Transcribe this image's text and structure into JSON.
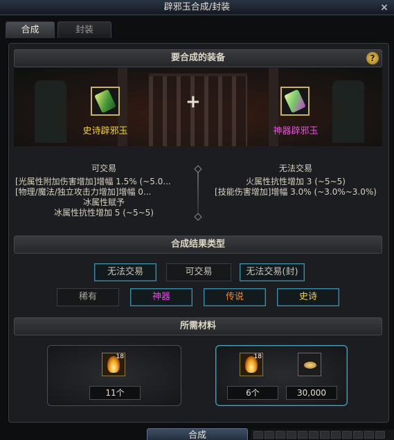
{
  "window": {
    "title": "辟邪玉合成/封装",
    "close_label": "×"
  },
  "tabs": [
    {
      "label": "合成",
      "active": true
    },
    {
      "label": "封装",
      "active": false
    }
  ],
  "equip_section": {
    "title": "要合成的装备",
    "help_label": "?"
  },
  "items": {
    "left": {
      "name": "史诗辟邪玉",
      "color": "#f2d23a",
      "icon": "epic-jade-card-icon"
    },
    "right": {
      "name": "神器辟邪玉",
      "color": "#e84fe0",
      "icon": "divine-jade-card-icon"
    },
    "plus_label": "+"
  },
  "left_info": {
    "trade": "可交易",
    "lines": [
      "[光属性附加伤害增加]增幅 1.5% (~5.0...",
      "[物理/魔法/独立攻击力增加]增幅 0...",
      "冰属性赋予",
      "冰属性抗性增加 5 (~5~5)"
    ]
  },
  "right_info": {
    "trade": "无法交易",
    "lines": [
      "火属性抗性增加 3 (~5~5)",
      "[技能伤害增加]增幅 3.0% (~3.0%~3.0%)"
    ]
  },
  "result_section": {
    "title": "合成结果类型"
  },
  "trade_options": [
    {
      "label": "无法交易",
      "selected": true
    },
    {
      "label": "可交易",
      "selected": false
    },
    {
      "label": "无法交易(封)",
      "selected": true
    }
  ],
  "rarity_options": [
    {
      "label": "稀有",
      "color": "#a9a59c",
      "selected": false
    },
    {
      "label": "神器",
      "color": "#e04be0",
      "selected": true
    },
    {
      "label": "传说",
      "color": "#f08a2a",
      "selected": true
    },
    {
      "label": "史诗",
      "color": "#f2d23a",
      "selected": true
    }
  ],
  "materials_section": {
    "title": "所需材料"
  },
  "materials": {
    "left": {
      "icon": "flame-stone-icon",
      "badge": "18",
      "quantity": "11个"
    },
    "right": {
      "icon": "flame-stone-icon",
      "badge": "18",
      "quantity": "6个",
      "gold_icon": "gold-coin-icon",
      "gold": "30,000"
    }
  },
  "craft_button": {
    "label": "合成"
  },
  "status_cells": [
    "",
    "",
    "",
    "",
    "",
    "",
    "",
    "",
    "",
    "",
    "",
    ""
  ]
}
